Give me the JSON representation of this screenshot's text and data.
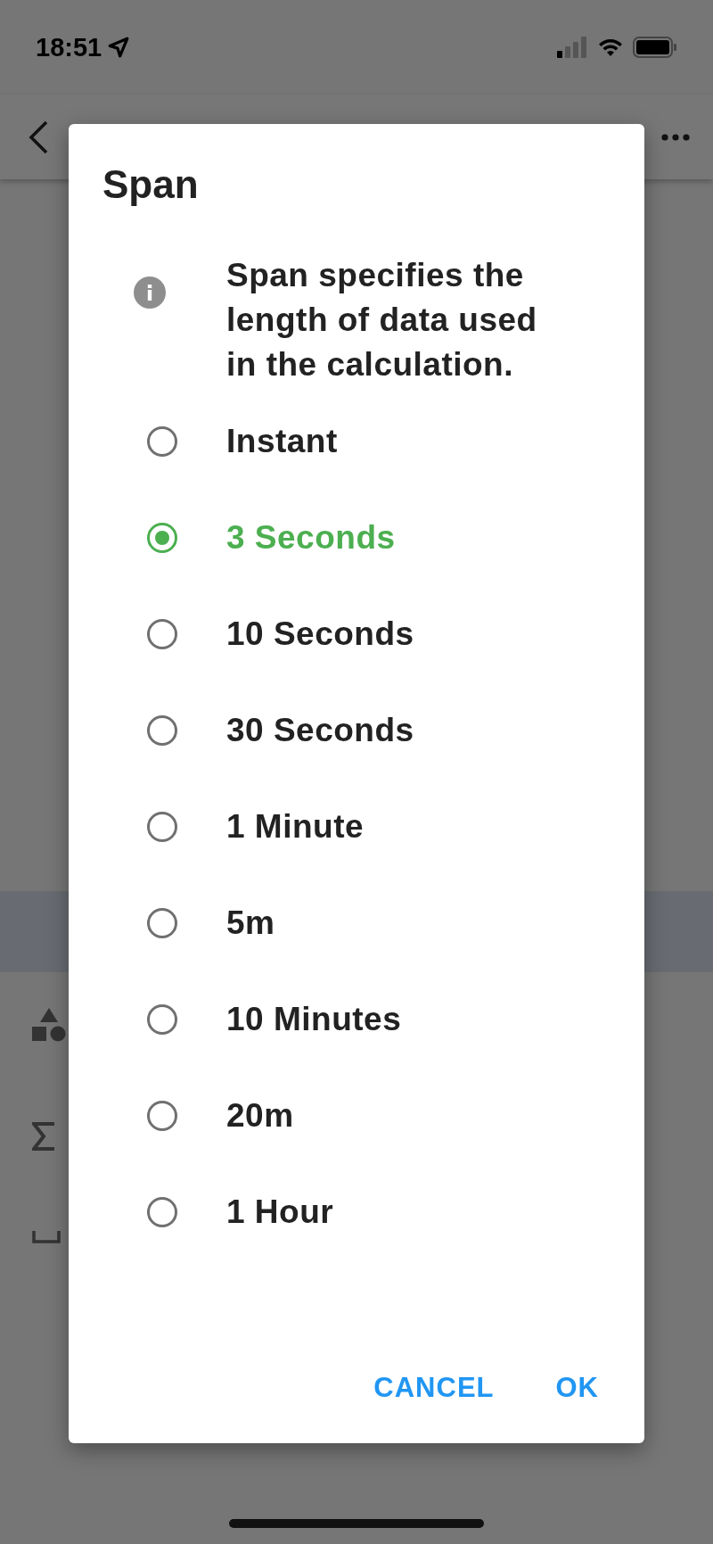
{
  "status_bar": {
    "time": "18:51"
  },
  "dialog": {
    "title": "Span",
    "info": "Span specifies the length of data used in the calculation.",
    "options": [
      {
        "label": "Instant",
        "selected": false
      },
      {
        "label": "3 Seconds",
        "selected": true
      },
      {
        "label": "10 Seconds",
        "selected": false
      },
      {
        "label": "30 Seconds",
        "selected": false
      },
      {
        "label": "1 Minute",
        "selected": false
      },
      {
        "label": "5m",
        "selected": false
      },
      {
        "label": "10 Minutes",
        "selected": false
      },
      {
        "label": "20m",
        "selected": false
      },
      {
        "label": "1 Hour",
        "selected": false
      }
    ],
    "buttons": [
      "CANCEL",
      "OK"
    ]
  }
}
